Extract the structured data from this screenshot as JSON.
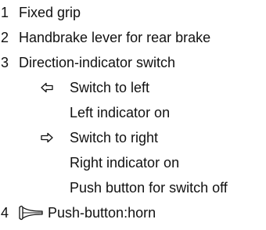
{
  "items": [
    {
      "number": "1",
      "label": "Fixed grip"
    },
    {
      "number": "2",
      "label": "Handbrake lever for rear brake"
    },
    {
      "number": "3",
      "label": "Direction-indicator switch"
    },
    {
      "number": "4",
      "label": "Push-button:horn"
    }
  ],
  "indicator": {
    "left_switch": "Switch to left",
    "left_on": "Left indicator on",
    "right_switch": "Switch to right",
    "right_on": "Right indicator on",
    "switch_off": "Push button for switch off"
  },
  "icons": {
    "left": "arrow-left-icon",
    "right": "arrow-right-icon",
    "horn": "horn-icon"
  }
}
